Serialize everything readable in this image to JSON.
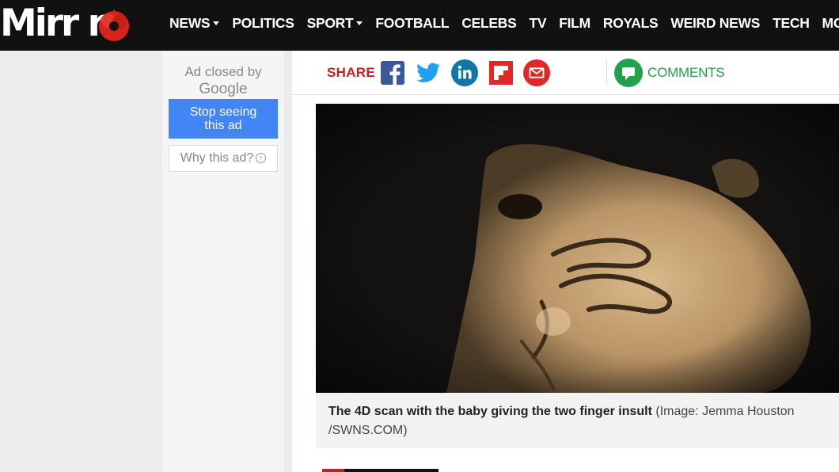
{
  "header": {
    "logo": "Mirr r",
    "nav": [
      {
        "label": "NEWS",
        "caret": true
      },
      {
        "label": "POLITICS",
        "caret": false
      },
      {
        "label": "SPORT",
        "caret": true
      },
      {
        "label": "FOOTBALL",
        "caret": false
      },
      {
        "label": "CELEBS",
        "caret": false
      },
      {
        "label": "TV",
        "caret": false
      },
      {
        "label": "FILM",
        "caret": false
      },
      {
        "label": "ROYALS",
        "caret": false
      },
      {
        "label": "WEIRD NEWS",
        "caret": false
      },
      {
        "label": "TECH",
        "caret": false
      },
      {
        "label": "MONEY",
        "caret": false
      }
    ],
    "bg_color": "#111111",
    "accent_color": "#c51f1f"
  },
  "ad": {
    "closed_line1": "Ad closed by",
    "closed_line2": "Google",
    "stop_line1": "Stop seeing",
    "stop_line2": "this ad",
    "why": "Why this ad?",
    "info_glyph": "i",
    "button_color": "#4285f4"
  },
  "share": {
    "label": "SHARE",
    "icons": [
      "facebook-icon",
      "twitter-icon",
      "linkedin-icon",
      "flipboard-icon",
      "email-icon"
    ],
    "comments": "COMMENTS",
    "comments_color": "#22a04a"
  },
  "photo": {
    "caption_bold": "The 4D scan with the baby giving the two finger insult",
    "caption_credit_line1": "(Image: Jemma Houston",
    "caption_credit_line2": "/SWNS.COM)"
  }
}
